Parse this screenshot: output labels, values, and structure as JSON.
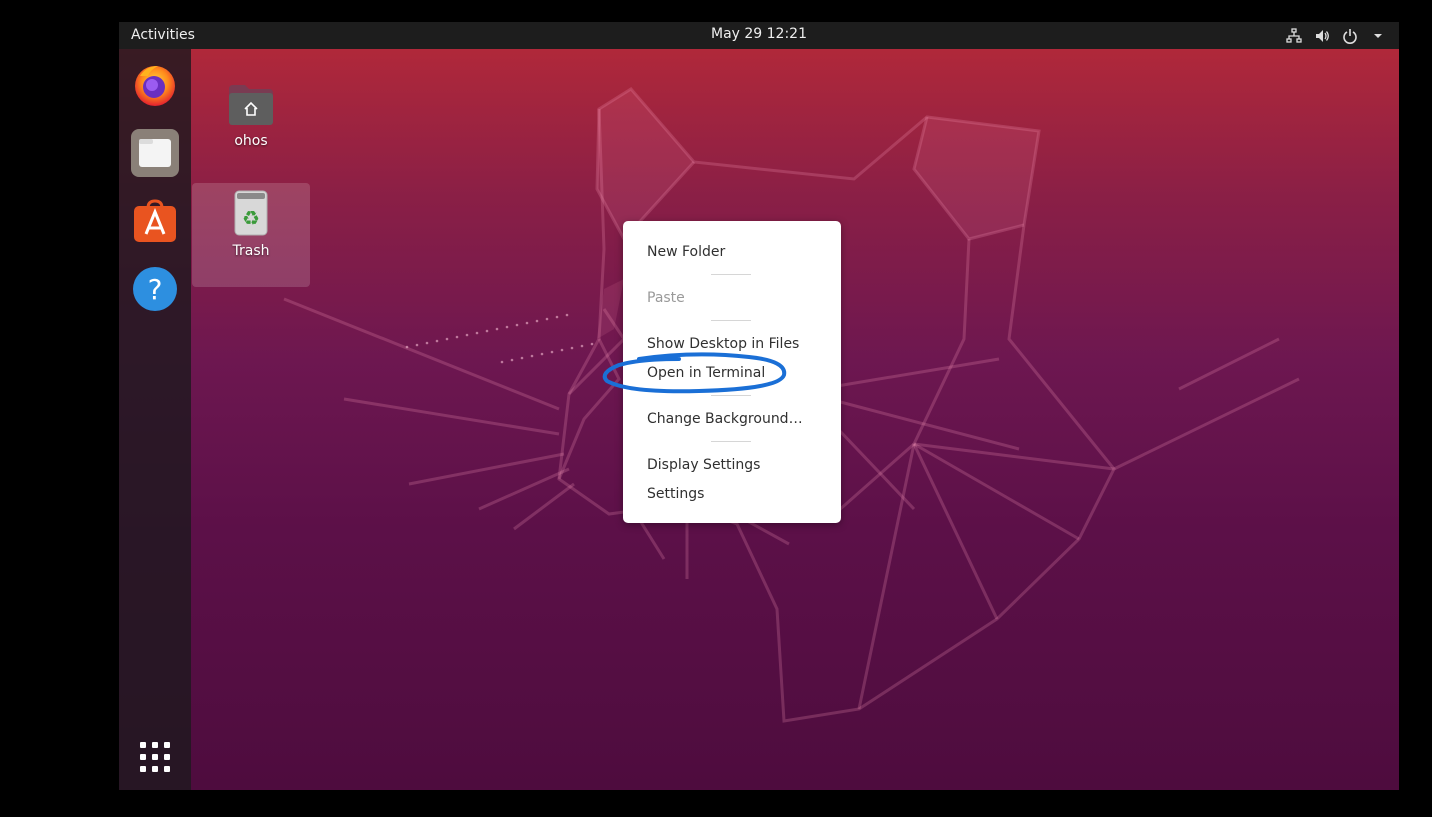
{
  "topbar": {
    "activities_label": "Activities",
    "clock": "May 29  12:21",
    "tray_icons": [
      "network-icon",
      "volume-icon",
      "power-icon",
      "chevron-down-icon"
    ]
  },
  "dock": {
    "items": [
      {
        "name": "firefox-icon"
      },
      {
        "name": "files-icon"
      },
      {
        "name": "software-center-icon"
      },
      {
        "name": "help-icon"
      }
    ],
    "show_apps_icon": "grid-icon"
  },
  "desktop": {
    "icons": [
      {
        "label": "ohos",
        "icon": "home-folder-icon"
      },
      {
        "label": "Trash",
        "icon": "trash-icon"
      }
    ]
  },
  "context_menu": {
    "new_folder": "New Folder",
    "paste": "Paste",
    "show_desktop_in_files": "Show Desktop in Files",
    "open_in_terminal": "Open in Terminal",
    "change_background": "Change Background…",
    "display_settings": "Display Settings",
    "settings": "Settings"
  },
  "colors": {
    "accent_orange": "#e95420",
    "annotation_blue": "#1a6fd6",
    "topbar": "#1d1d1d",
    "menu_bg": "#ffffff"
  }
}
